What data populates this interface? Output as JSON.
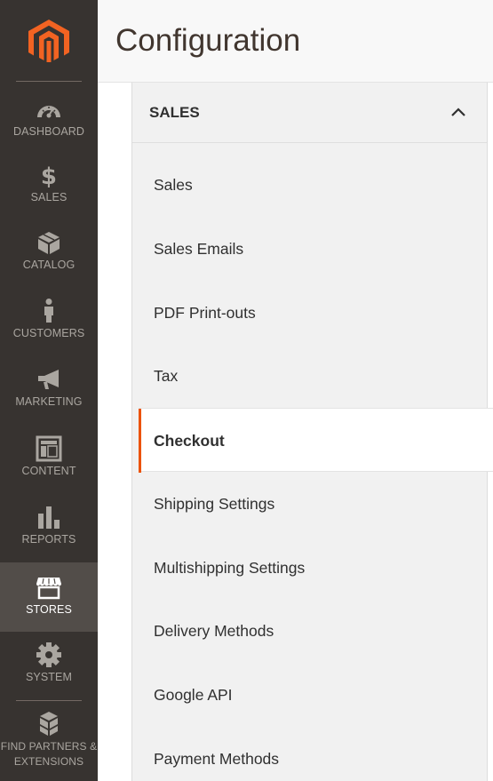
{
  "header": {
    "title": "Configuration"
  },
  "sidebar": {
    "items": [
      {
        "label": "DASHBOARD",
        "icon": "dashboard-icon"
      },
      {
        "label": "SALES",
        "icon": "dollar-icon"
      },
      {
        "label": "CATALOG",
        "icon": "box-icon"
      },
      {
        "label": "CUSTOMERS",
        "icon": "person-icon"
      },
      {
        "label": "MARKETING",
        "icon": "megaphone-icon"
      },
      {
        "label": "CONTENT",
        "icon": "layout-icon"
      },
      {
        "label": "REPORTS",
        "icon": "bar-chart-icon"
      },
      {
        "label": "STORES",
        "icon": "storefront-icon",
        "active": true
      },
      {
        "label": "SYSTEM",
        "icon": "gear-icon"
      },
      {
        "label": "FIND PARTNERS & EXTENSIONS",
        "icon": "blocks-icon"
      }
    ]
  },
  "panel": {
    "title": "SALES",
    "items": [
      "Sales",
      "Sales Emails",
      "PDF Print-outs",
      "Tax",
      "Checkout",
      "Shipping Settings",
      "Multishipping Settings",
      "Delivery Methods",
      "Google API",
      "Payment Methods"
    ],
    "active_index": 4
  },
  "colors": {
    "sidebar_bg": "#373330",
    "active_nav_bg": "#524d49",
    "accent": "#eb5202"
  }
}
